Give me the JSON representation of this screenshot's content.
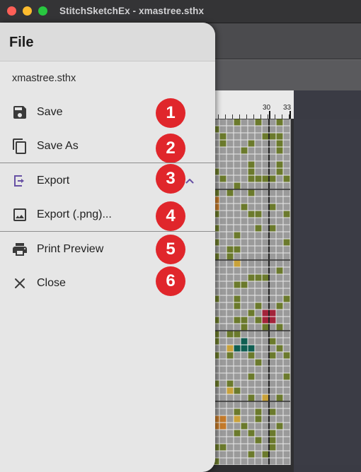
{
  "window": {
    "title": "StitchSketchEx - xmastree.sthx"
  },
  "drawer": {
    "title": "File",
    "filename": "xmastree.sthx",
    "items": [
      {
        "label": "Save",
        "icon": "save-icon",
        "badge": "1"
      },
      {
        "label": "Save As",
        "icon": "save-as-icon",
        "badge": "2"
      },
      {
        "label": "Export",
        "icon": "export-icon",
        "badge": "3",
        "expanded": true
      },
      {
        "label": "Export (.png)...",
        "icon": "image-icon",
        "badge": "4"
      },
      {
        "label": "Print Preview",
        "icon": "print-icon",
        "badge": "5"
      },
      {
        "label": "Close",
        "icon": "close-icon",
        "badge": "6"
      }
    ]
  },
  "ruler": {
    "label_30": "30",
    "label_33": "33"
  },
  "colors": {
    "accent": "#6750a4",
    "badge": "#e0262b",
    "olive": "#6b7a2c",
    "gold": "#c9a23a",
    "crimson": "#a3233a",
    "teal": "#0f5e52",
    "orange": "#c47a2a"
  }
}
